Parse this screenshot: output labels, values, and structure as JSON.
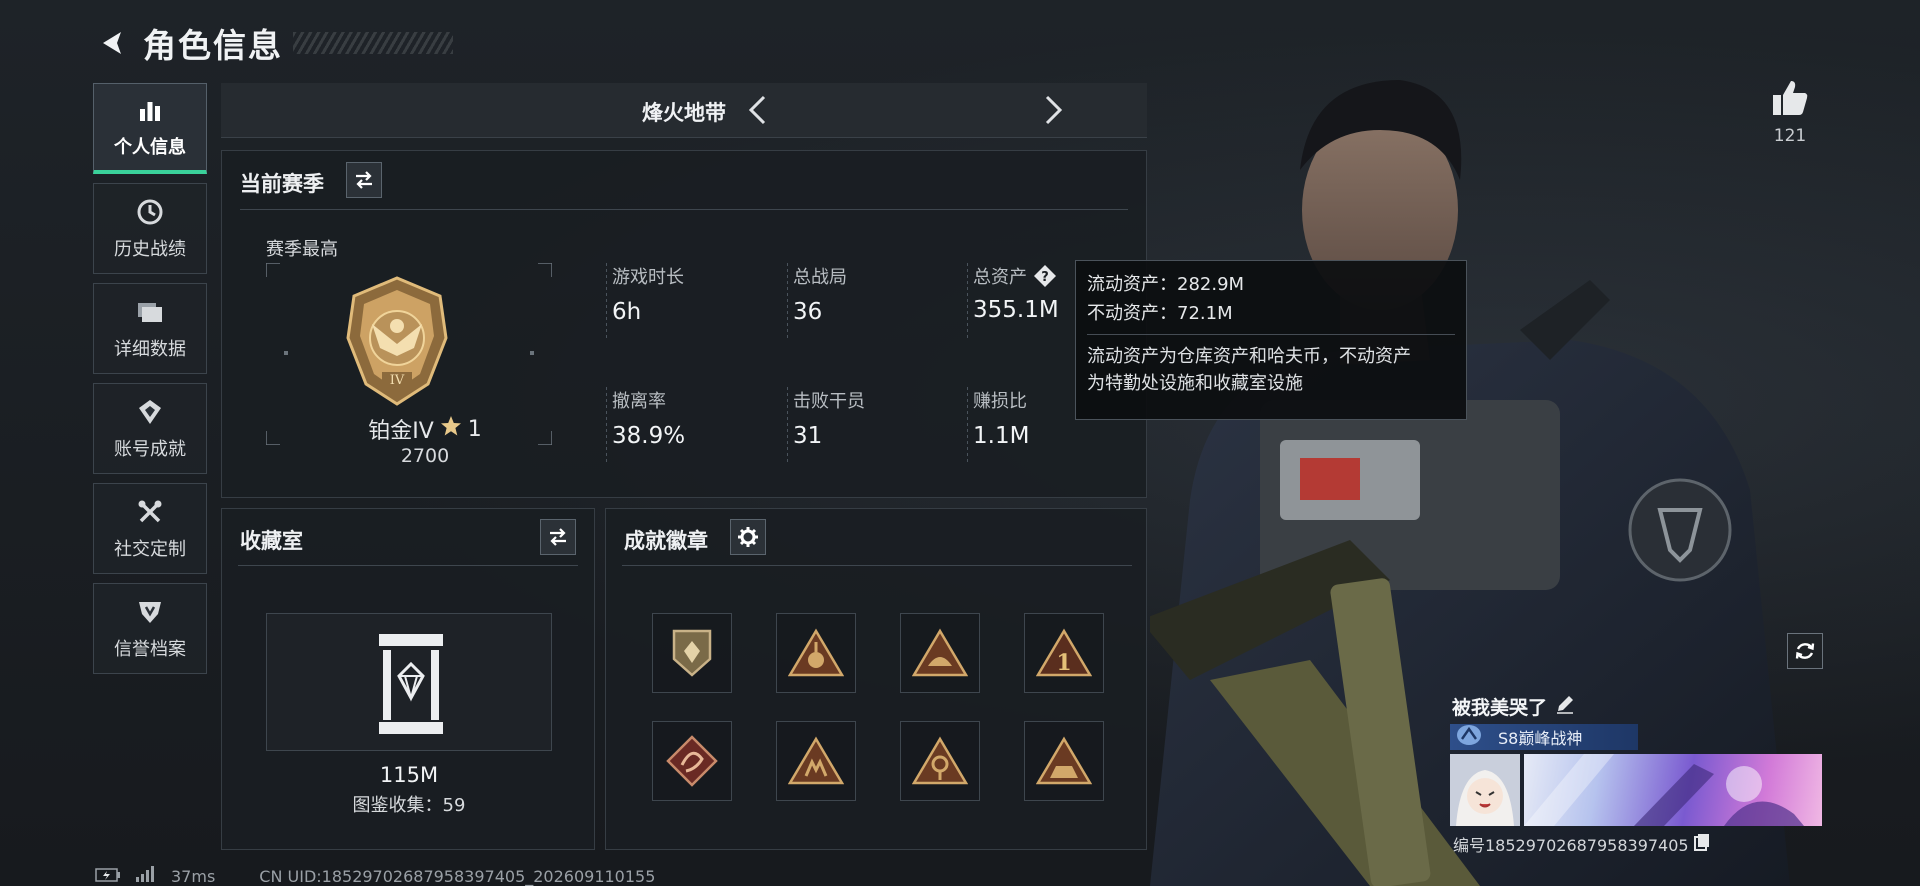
{
  "header": {
    "title": "角色信息"
  },
  "sidebar": {
    "items": [
      {
        "label": "个人信息",
        "icon": "bar-chart-icon",
        "active": true
      },
      {
        "label": "历史战绩",
        "icon": "clock-icon"
      },
      {
        "label": "详细数据",
        "icon": "folder-icon"
      },
      {
        "label": "账号成就",
        "icon": "achievement-icon"
      },
      {
        "label": "社交定制",
        "icon": "tools-icon"
      },
      {
        "label": "信誉档案",
        "icon": "shield-icon"
      }
    ]
  },
  "mode_nav": {
    "name": "烽火地带"
  },
  "season": {
    "title": "当前赛季",
    "best_label": "赛季最高",
    "rank_name": "铂金IV",
    "rank_stars": "1",
    "rank_score": "2700",
    "rank_numeral": "IV",
    "stats": [
      {
        "label": "游戏时长",
        "value": "6h"
      },
      {
        "label": "总战局",
        "value": "36"
      },
      {
        "label": "总资产",
        "value": "355.1M"
      },
      {
        "label": "撤离率",
        "value": "38.9%"
      },
      {
        "label": "击败干员",
        "value": "31"
      },
      {
        "label": "赚损比",
        "value": "1.1M"
      }
    ]
  },
  "tooltip": {
    "liquid": "流动资产：282.9M",
    "fixed": "不动资产：72.1M",
    "desc_line1": "流动资产为仓库资产和哈夫币，不动资产",
    "desc_line2": "为特勤处设施和收藏室设施"
  },
  "collection": {
    "title": "收藏室",
    "value": "115M",
    "collected": "图鉴收集：59"
  },
  "achievements": {
    "title": "成就徽章",
    "badges": [
      "badge-1",
      "badge-2",
      "badge-3",
      "badge-4",
      "badge-5",
      "badge-6",
      "badge-7",
      "badge-8"
    ]
  },
  "likes": {
    "count": "121"
  },
  "player": {
    "name": "被我美哭了",
    "title": "S8巅峰战神",
    "id_line": "编号1852970268795839740​5"
  },
  "footer": {
    "ping": "37ms",
    "uid": "CN UID:18529702687958397405_202609110155"
  },
  "colors": {
    "accent": "#3ad19a",
    "gold": "#c9a062",
    "title_blue": "#2e4f8a"
  }
}
